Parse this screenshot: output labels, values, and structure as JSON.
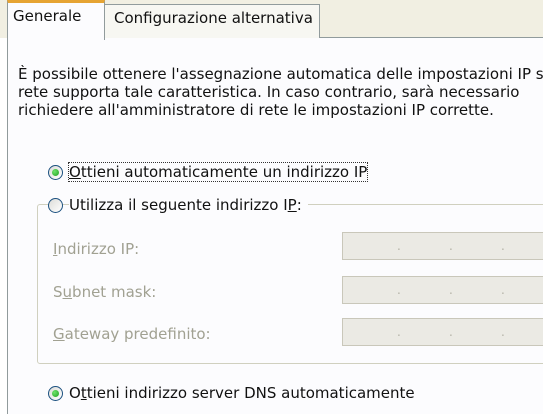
{
  "tabs": [
    {
      "label": "Generale",
      "active": true
    },
    {
      "label": "Configurazione alternativa",
      "active": false
    }
  ],
  "description": {
    "line1": "È possibile ottenere l'assegnazione automatica delle impostazioni IP se la",
    "line2": "rete supporta tale caratteristica. In caso contrario, sarà necessario",
    "line3": "richiedere all'amministratore di rete le impostazioni IP corrette."
  },
  "ip_options": {
    "auto": {
      "pre": "",
      "key": "O",
      "post": "ttieni automaticamente un indirizzo IP",
      "selected": true
    },
    "manual": {
      "pre": "Utilizza il seguente indirizzo I",
      "key": "P",
      "post": ":",
      "selected": false
    }
  },
  "fields": [
    {
      "pre": "",
      "key": "I",
      "post": "ndirizzo IP:",
      "value": ""
    },
    {
      "pre": "S",
      "key": "u",
      "post": "bnet mask:",
      "value": ""
    },
    {
      "pre": "",
      "key": "G",
      "post": "ateway predefinito:",
      "value": ""
    }
  ],
  "dns_options": {
    "auto": {
      "pre": "O",
      "key": "t",
      "post": "tieni indirizzo server DNS automaticamente",
      "selected": true
    }
  },
  "colors": {
    "tab_highlight": "#e6a433",
    "radio_selected": "#21a121"
  }
}
